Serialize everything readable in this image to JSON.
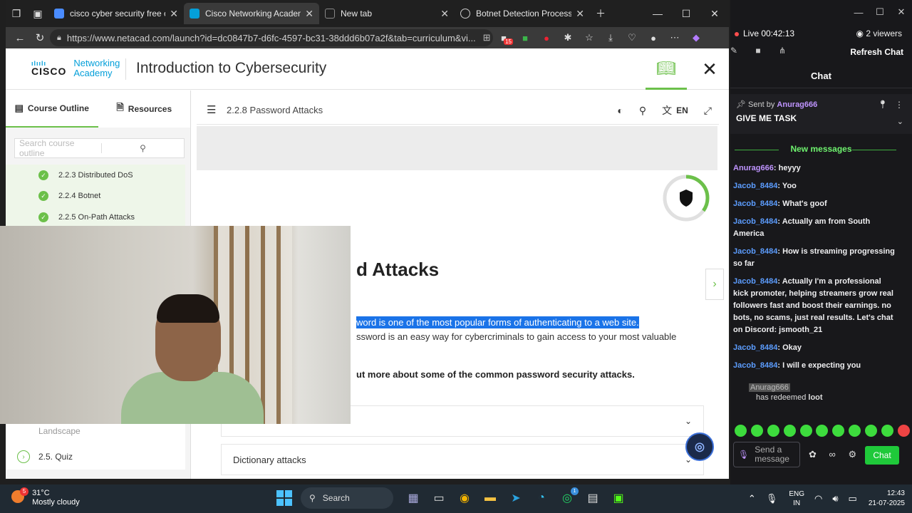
{
  "browser": {
    "tabs": [
      {
        "title": "cisco cyber security free course",
        "fav_color": "#4a8cff"
      },
      {
        "title": "Cisco Networking Academy: Intro",
        "fav_color": "#049fd9"
      },
      {
        "title": "New tab",
        "fav_color": "#888888"
      },
      {
        "title": "Botnet Detection Process",
        "fav_color": "#cccccc"
      }
    ],
    "url": "https://www.netacad.com/launch?id=dc0847b7-d6fc-4597-bc31-38ddd6b07a2f&tab=curriculum&vi...",
    "ext_badge": "15"
  },
  "page": {
    "logo_text": "CISCO",
    "logo_sub1": "Networking",
    "logo_sub2": "Academy",
    "course_title": "Introduction to Cybersecurity",
    "side_tabs": {
      "outline": "Course Outline",
      "resources": "Resources"
    },
    "search_placeholder": "Search course outline",
    "outline_items": [
      "2.2.3 Distributed DoS",
      "2.2.4 Botnet",
      "2.2.5 On-Path Attacks"
    ],
    "outline_bottom": [
      "Landscape",
      "2.5. Quiz"
    ],
    "section_title": "2.2.8 Password Attacks",
    "lang": "EN",
    "heading": "d Attacks",
    "para1": "word is one of the most popular forms of authenticating to a web site.",
    "para2": "ssword is an easy way for cybercriminals to gain access to your most valuable",
    "para3": "ut more about some of the common password security attacks.",
    "accordions": [
      "",
      "Dictionary attacks"
    ],
    "progress": 0.35
  },
  "stream": {
    "live": "Live 00:42:13",
    "viewers": "2 viewers",
    "refresh": "Refresh Chat",
    "chat_title": "Chat",
    "pinned_by_label": "Sent by",
    "pinned_by": "Anurag666",
    "pinned_msg": "GIVE ME TASK",
    "new_messages": "New messages",
    "messages": [
      {
        "user": "Anurag666",
        "text": "heyyy",
        "purple": true
      },
      {
        "user": "Jacob_8484",
        "text": "Yoo"
      },
      {
        "user": "Jacob_8484",
        "text": "What's goof"
      },
      {
        "user": "Jacob_8484",
        "text": "Actually am from South America"
      },
      {
        "user": "Jacob_8484",
        "text": "How is streaming progressing so far"
      },
      {
        "user": "Jacob_8484",
        "text": "Actually I'm a professional kick promoter, helping streamers grow real followers fast and boost their earnings. no bots, no scams, just real results. Let's chat on Discord: jsmooth_21"
      },
      {
        "user": "Jacob_8484",
        "text": "Okay"
      },
      {
        "user": "Jacob_8484",
        "text": "I will e expecting you"
      }
    ],
    "redeem_user": "Anurag666",
    "redeem_text_pre": "has redeemed",
    "redeem_item": "loot",
    "input_placeholder": "Send a message",
    "chat_button": "Chat"
  },
  "taskbar": {
    "temp": "31°C",
    "weather": "Mostly cloudy",
    "weather_badge": "5",
    "search": "Search",
    "whatsapp_badge": "1",
    "lang1": "ENG",
    "lang2": "IN",
    "time": "12:43",
    "date": "21-07-2025"
  }
}
